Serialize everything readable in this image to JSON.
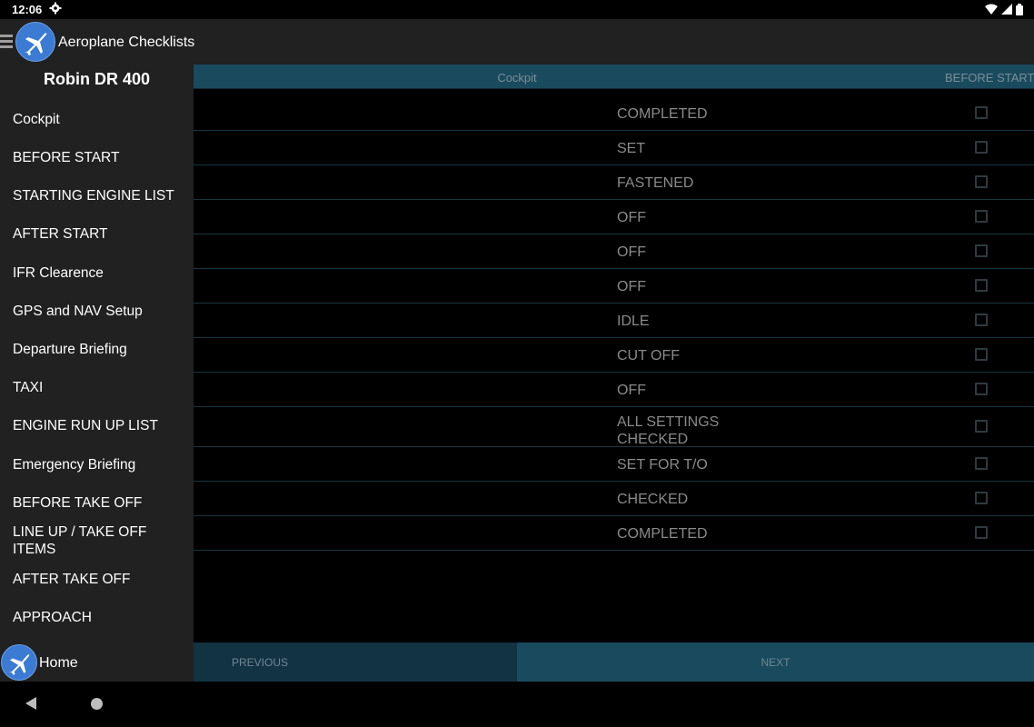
{
  "status": {
    "time": "12:06"
  },
  "app": {
    "title": "Aeroplane Checklists"
  },
  "sidebar": {
    "title": "Robin DR 400",
    "items": [
      "Cockpit",
      "BEFORE START",
      "STARTING ENGINE LIST",
      "AFTER START",
      "IFR Clearence",
      "GPS and NAV Setup",
      "Departure Briefing",
      "TAXI",
      "ENGINE RUN UP LIST",
      "Emergency Briefing",
      "BEFORE TAKE OFF",
      "LINE UP / TAKE OFF ITEMS",
      "AFTER TAKE OFF",
      "APPROACH"
    ],
    "home_label": "Home"
  },
  "main": {
    "current_section": "Cockpit",
    "next_section": "BEFORE START",
    "rows": [
      {
        "value": "COMPLETED",
        "checked": false
      },
      {
        "value": "SET",
        "checked": false
      },
      {
        "value": "FASTENED",
        "checked": false
      },
      {
        "value": "OFF",
        "checked": false
      },
      {
        "value": "OFF",
        "checked": false
      },
      {
        "value": "OFF",
        "checked": false
      },
      {
        "value": "IDLE",
        "checked": false
      },
      {
        "value": "CUT OFF",
        "checked": false
      },
      {
        "value": "OFF",
        "checked": false
      },
      {
        "value": "ALL SETTINGS\nCHECKED",
        "checked": false
      },
      {
        "value": "SET FOR T/O",
        "checked": false
      },
      {
        "value": "CHECKED",
        "checked": false
      },
      {
        "value": "COMPLETED",
        "checked": false
      }
    ],
    "previous_label": "PREVIOUS",
    "next_label": "NEXT"
  },
  "colors": {
    "accent": "#1a4a5e",
    "footer_prev": "#123342",
    "logo_blue": "#3b7bd4"
  }
}
